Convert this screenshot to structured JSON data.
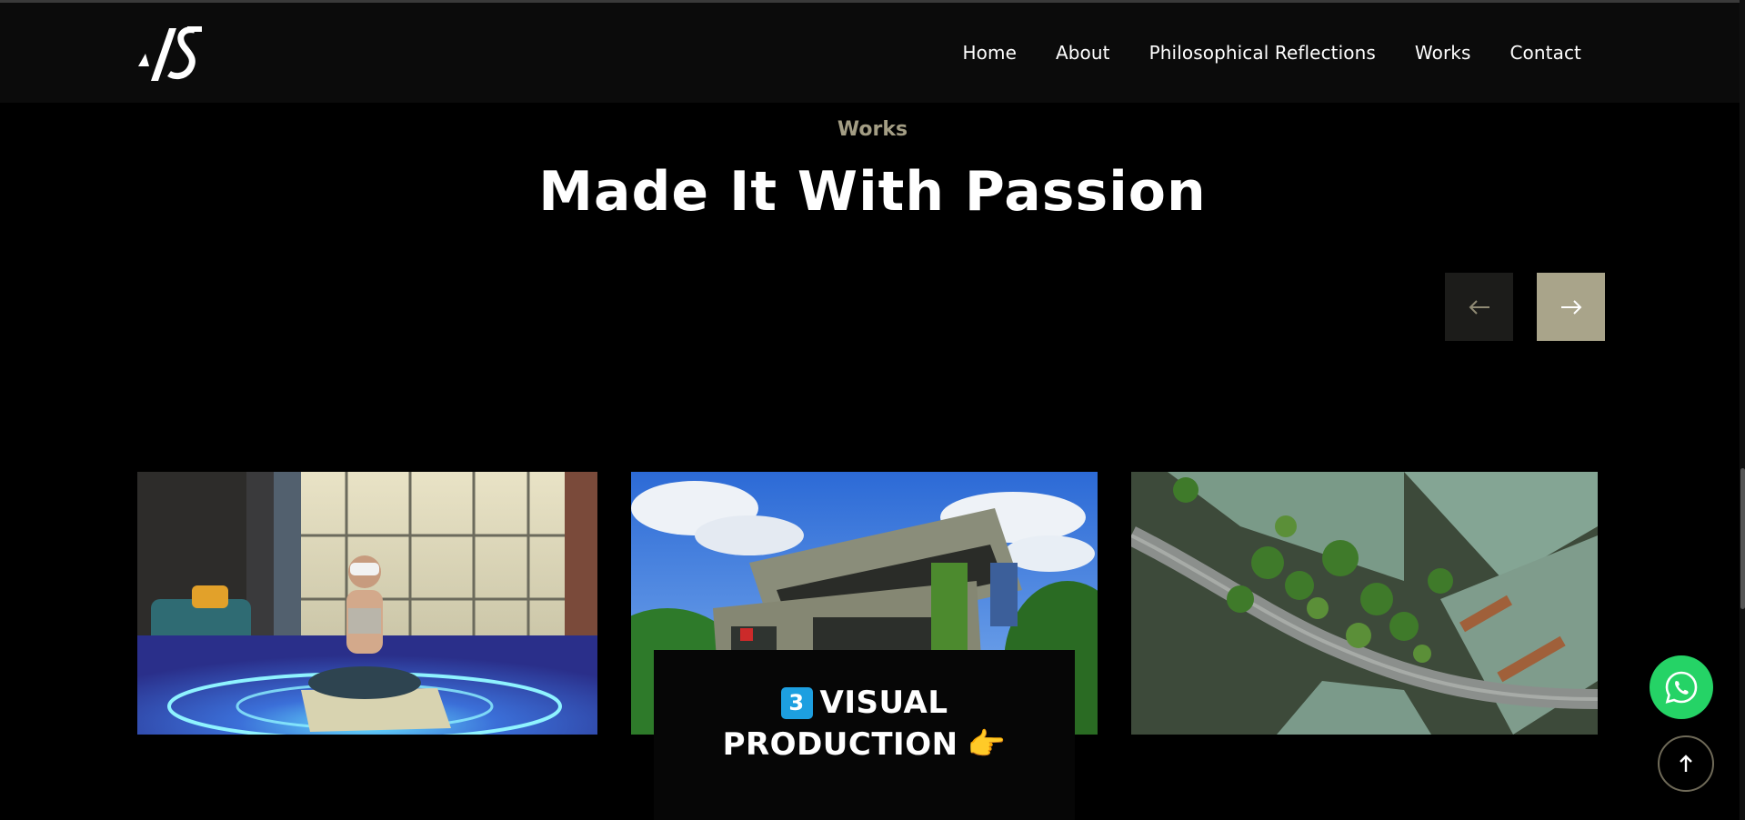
{
  "nav": {
    "logo_alt": "AS",
    "items": [
      {
        "label": "Home"
      },
      {
        "label": "About"
      },
      {
        "label": "Philosophical Reflections"
      },
      {
        "label": "Works"
      },
      {
        "label": "Contact"
      }
    ]
  },
  "section": {
    "eyebrow": "Works",
    "headline": "Made It With Passion"
  },
  "slider": {
    "prev_icon": "arrow-left-icon",
    "next_icon": "arrow-right-icon"
  },
  "cards": [
    {
      "name": "vr-meditation-work",
      "icon": "image"
    },
    {
      "name": "green-building-work",
      "icon": "image"
    },
    {
      "name": "aerial-landscape-work",
      "icon": "image"
    }
  ],
  "overlay": {
    "badge": "3",
    "line1": "VISUAL",
    "line2": "PRODUCTION",
    "emoji": "👉"
  },
  "floating": {
    "whatsapp_icon": "whatsapp-icon",
    "back_to_top_icon": "arrow-up-icon"
  },
  "colors": {
    "background": "#000000",
    "navbar": "#0b0b0b",
    "accent": "#a9a48a",
    "eyebrow": "#a39d84",
    "whatsapp": "#25d366",
    "badge": "#1d9fe0"
  }
}
